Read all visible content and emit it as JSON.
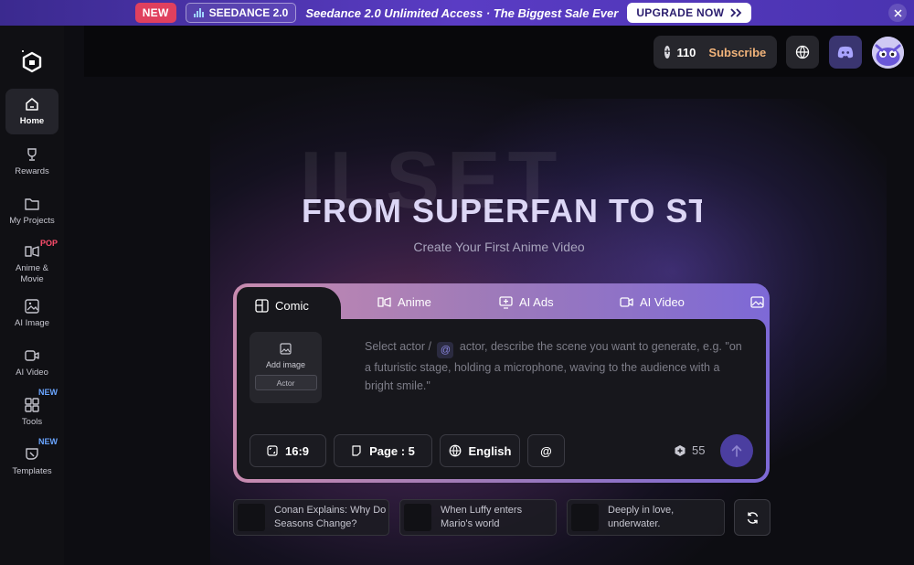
{
  "banner": {
    "new_badge": "NEW",
    "product": "SEEDANCE 2.0",
    "promo": "Seedance 2.0 Unlimited Access · The Biggest Sale Ever",
    "upgrade": "UPGRADE NOW",
    "close_icon": "close-icon"
  },
  "sidebar": {
    "items": [
      {
        "label": "Home",
        "icon": "home-icon",
        "active": true
      },
      {
        "label": "Rewards",
        "icon": "trophy-icon"
      },
      {
        "label": "My Projects",
        "icon": "folder-icon"
      },
      {
        "label": "Anime & Movie",
        "icon": "film-icon",
        "tag": "POP"
      },
      {
        "label": "AI Image",
        "icon": "image-icon"
      },
      {
        "label": "AI Video",
        "icon": "video-icon"
      },
      {
        "label": "Tools",
        "icon": "grid-icon",
        "tag": "NEW"
      },
      {
        "label": "Templates",
        "icon": "template-icon",
        "tag": "NEW"
      }
    ]
  },
  "header": {
    "credits": "110",
    "subscribe": "Subscribe"
  },
  "hero": {
    "background_word": "ILSET",
    "headline": "FROM SUPERFAN TO STU",
    "subheadline": "Create Your First Anime Video"
  },
  "composer": {
    "tabs": [
      {
        "label": "Comic",
        "icon": "comic-icon",
        "active": true
      },
      {
        "label": "Anime",
        "icon": "film-icon"
      },
      {
        "label": "AI Ads",
        "icon": "ads-icon"
      },
      {
        "label": "AI Video",
        "icon": "video-icon"
      },
      {
        "label": "",
        "icon": "image-icon"
      }
    ],
    "add_image_label": "Add image",
    "actor_label": "Actor",
    "prompt_part1": "Select actor /",
    "prompt_at": "@",
    "prompt_part2": "actor, describe the scene you want to generate, e.g. \"on a futuristic stage, holding a microphone, waving to the audience with a bright smile.\"",
    "aspect": "16:9",
    "pages": "Page : 5",
    "language": "English",
    "mention": "@",
    "cost": "55"
  },
  "suggestions": [
    {
      "text": "Conan Explains: Why Do Seasons Change?"
    },
    {
      "text": "When Luffy enters Mario's world"
    },
    {
      "text": "Deeply in love, underwater."
    }
  ],
  "colors": {
    "accent": "#5a3cc4",
    "badge_new": "#e0405e",
    "subscribe": "#f1b37a",
    "pop_tag": "#ff4d6d",
    "new_tag": "#6aa5ff"
  }
}
